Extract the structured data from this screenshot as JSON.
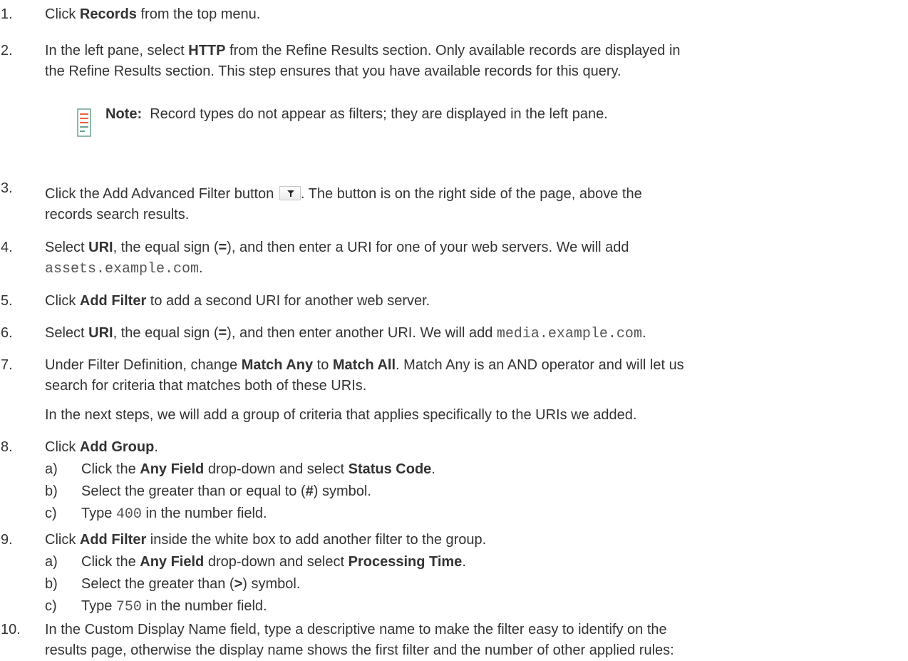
{
  "steps": [
    {
      "n": "1.",
      "parts": [
        "Click ",
        "Records",
        " from the top menu."
      ]
    },
    {
      "n": "2.",
      "line1": [
        "In the left pane, select ",
        "HTTP",
        " from the Refine Results section. Only available records are displayed in"
      ],
      "line2": "the Refine Results section. This step ensures that you have available records for this query."
    },
    {
      "n": "3.",
      "line1a": "Click the Add Advanced Filter button ",
      "line1b": ". The button is on the right side of the page, above the",
      "line2": "records search results."
    },
    {
      "n": "4.",
      "line1": [
        "Select ",
        "URI",
        ", the equal sign (",
        "=",
        "), and then enter a URI for one of your web servers. We will add"
      ],
      "code": "assets.example.com",
      "tail": "."
    },
    {
      "n": "5.",
      "parts": [
        "Click ",
        "Add Filter",
        " to add a second URI for another web server."
      ]
    },
    {
      "n": "6.",
      "parts": [
        "Select ",
        "URI",
        ", the equal sign (",
        "=",
        "), and then enter another URI. We will add "
      ],
      "code": "media.example.com",
      "tail": "."
    },
    {
      "n": "7.",
      "line1": [
        "Under Filter Definition, change ",
        "Match Any",
        " to ",
        "Match All",
        ". Match Any is an AND operator and will let us"
      ],
      "line2": "search for criteria that matches both of these URIs.",
      "para": "In the next steps, we will add a group of criteria that applies specifically to the URIs we added."
    },
    {
      "n": "8.",
      "parts": [
        "Click ",
        "Add Group",
        "."
      ]
    },
    {
      "n": "9.",
      "parts": [
        "Click ",
        "Add Filter",
        " inside the white box to add another filter to the group."
      ]
    },
    {
      "n": "10.",
      "line1": "In the Custom Display Name field, type a descriptive name to make the filter easy to identify on the",
      "line2": "results page, otherwise the display name shows the first filter and the number of other applied rules:"
    }
  ],
  "note": {
    "label": "Note:",
    "text": "Record types do not appear as filters; they are displayed in the left pane."
  },
  "sub8": [
    {
      "n": "a)",
      "parts": [
        "Click the ",
        "Any Field",
        " drop-down and select ",
        "Status Code",
        "."
      ]
    },
    {
      "n": "b)",
      "parts": [
        "Select the greater than or equal to (",
        "#",
        ") symbol."
      ]
    },
    {
      "n": "c)",
      "pre": "Type ",
      "code": "400",
      "post": " in the number field."
    }
  ],
  "sub9": [
    {
      "n": "a)",
      "parts": [
        "Click the ",
        "Any Field",
        " drop-down and select ",
        "Processing Time",
        "."
      ]
    },
    {
      "n": "b)",
      "parts": [
        "Select the greater than (",
        ">",
        ") symbol."
      ]
    },
    {
      "n": "c)",
      "pre": "Type ",
      "code": "750",
      "post": " in the number field."
    }
  ],
  "icons": {
    "note": "note-icon",
    "filter": "filter-icon"
  },
  "colors": {
    "text": "#333333",
    "note_icon": "#e8613c",
    "note_icon_border": "#6aa38e"
  }
}
